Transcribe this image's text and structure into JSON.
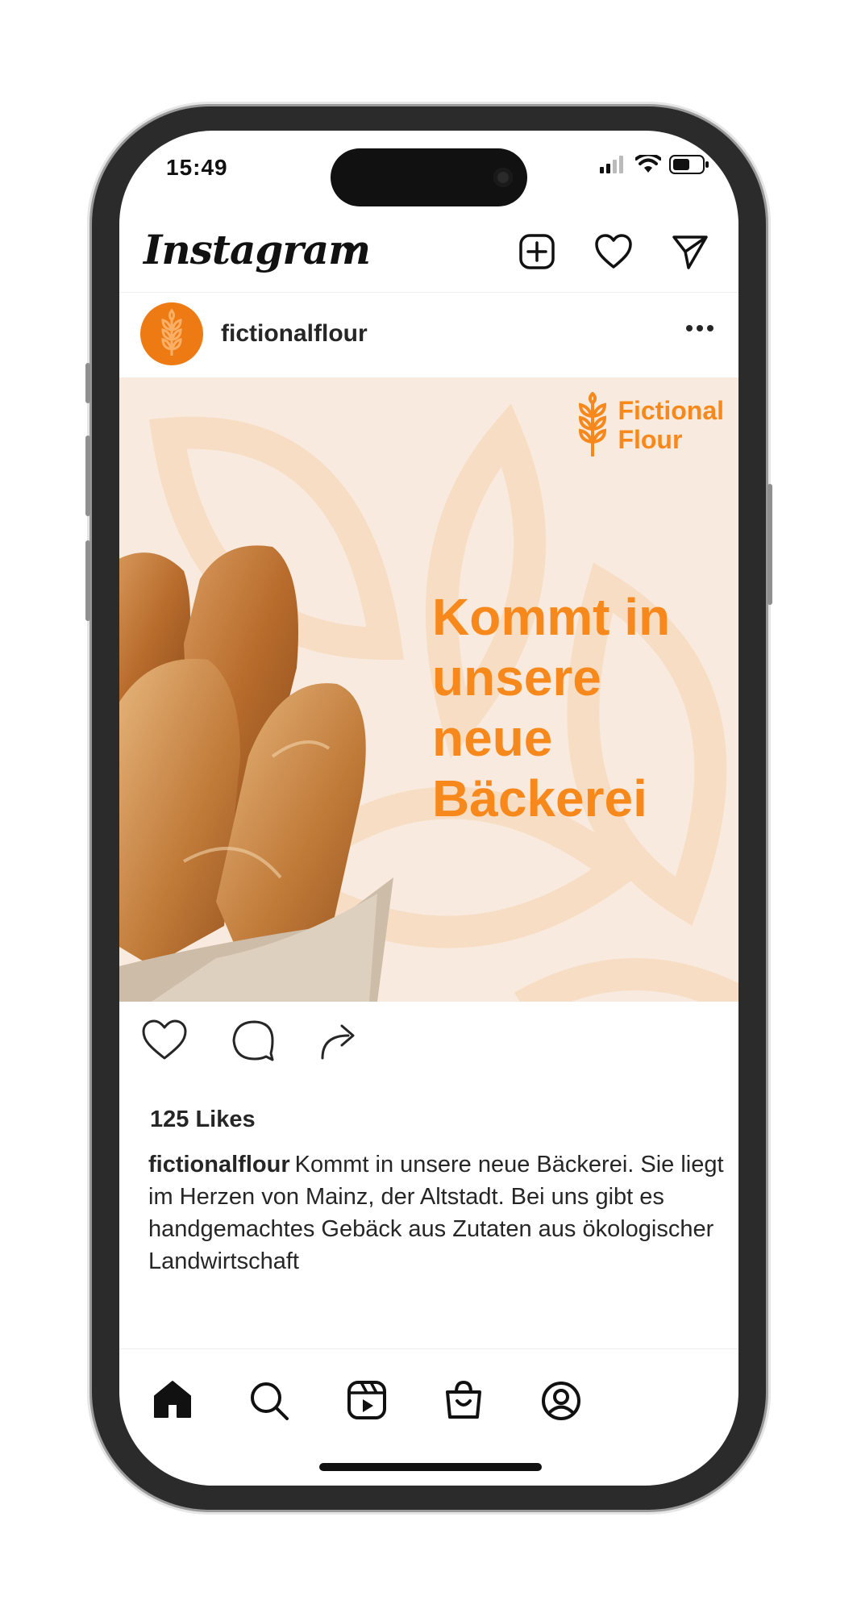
{
  "status_bar": {
    "time": "15:49"
  },
  "app": {
    "title": "Instagram"
  },
  "post": {
    "username": "fictionalflour",
    "brand_line1": "Fictional",
    "brand_line2": "Flour",
    "headline": "Kommt in unsere neue Bäckerei",
    "likes": "125 Likes",
    "caption_user": "fictionalflour",
    "caption_text": "Kommt in unsere neue Bäckerei. Sie liegt im Herzen von Mainz, der Altstadt. Bei uns gibt es handgemachtes Gebäck aus Zutaten aus ökologischer Landwirtschaft"
  },
  "icons": {
    "top": [
      "new-post-icon",
      "heart-icon",
      "direct-message-icon"
    ],
    "post_actions": [
      "like-icon",
      "comment-icon",
      "share-icon"
    ],
    "bottom_nav": [
      "home-icon",
      "search-icon",
      "reels-icon",
      "shop-icon",
      "profile-icon"
    ]
  },
  "colors": {
    "brand_orange": "#f7891c",
    "post_background": "#f8eade",
    "avatar": "#ee7a14"
  }
}
